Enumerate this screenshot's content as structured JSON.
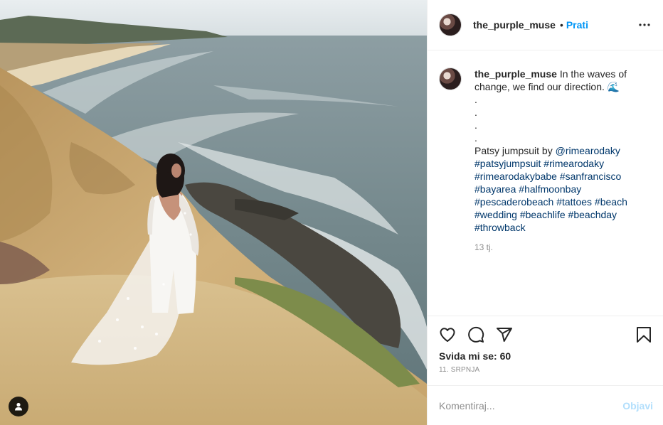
{
  "post": {
    "author": "the_purple_muse",
    "follow_label": "Prati",
    "separator": "•",
    "caption": {
      "text": "In the waves of change, we find our direction. 🌊",
      "dots": [
        ".",
        ".",
        ".",
        "."
      ],
      "credit_prefix": "Patsy jumpsuit by",
      "mention": "@rimearodaky",
      "hashtags": [
        "#patsyjumpsuit",
        "#rimearodaky",
        "#rimearodakybabe",
        "#sanfrancisco",
        "#bayarea",
        "#halfmoonbay",
        "#pescaderobeach",
        "#tattoes",
        "#beach",
        "#wedding",
        "#beachlife",
        "#beachday",
        "#throwback"
      ],
      "time_ago": "13 tj."
    },
    "likes_label": "Svida mi se: 60",
    "date": "11. SRPNJA",
    "comment_placeholder": "Komentiraj...",
    "post_button": "Objavi"
  },
  "icons": {
    "more": "more-horizontal-icon",
    "like": "heart-icon",
    "comment": "comment-icon",
    "share": "paper-plane-icon",
    "save": "bookmark-icon",
    "user_tag": "user-tag-icon"
  },
  "colors": {
    "link_blue": "#0095f6",
    "hashtag": "#00376b",
    "muted": "#8e8e8e",
    "border": "#efefef"
  }
}
